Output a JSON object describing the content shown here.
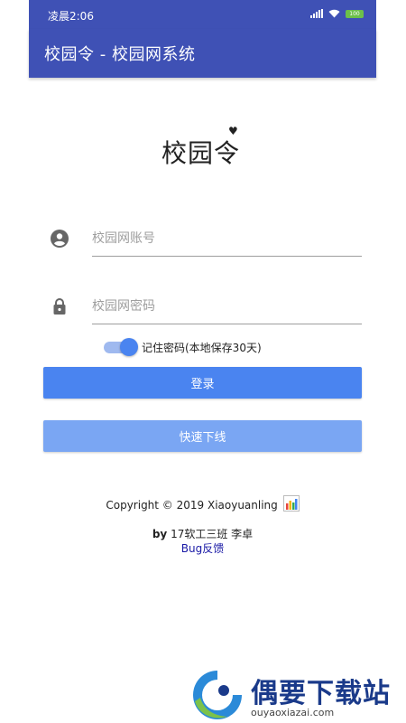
{
  "status_bar": {
    "time": "凌晨2:06",
    "battery": "100"
  },
  "app_bar": {
    "title": "校园令 - 校园网系统"
  },
  "logo": {
    "text": "校园令"
  },
  "form": {
    "account_placeholder": "校园网账号",
    "account_value": "",
    "password_placeholder": "校园网密码",
    "password_value": "",
    "remember_label": "记住密码(本地保存30天)",
    "remember_checked": true
  },
  "buttons": {
    "login_label": "登录",
    "offline_label": "快速下线"
  },
  "footer": {
    "copyright": "Copyright © 2019 Xiaoyuanling",
    "credit_by": "by",
    "credit_text": " 17软工三班 李卓",
    "bug_link": "Bug反馈"
  },
  "watermark": {
    "title": "偶要下载站",
    "url": "ouyaoxiazai.com"
  },
  "colors": {
    "primary": "#3f51b5",
    "button": "#4a84f0",
    "button_light": "#7aa6f3",
    "link": "#1a1aa6"
  }
}
